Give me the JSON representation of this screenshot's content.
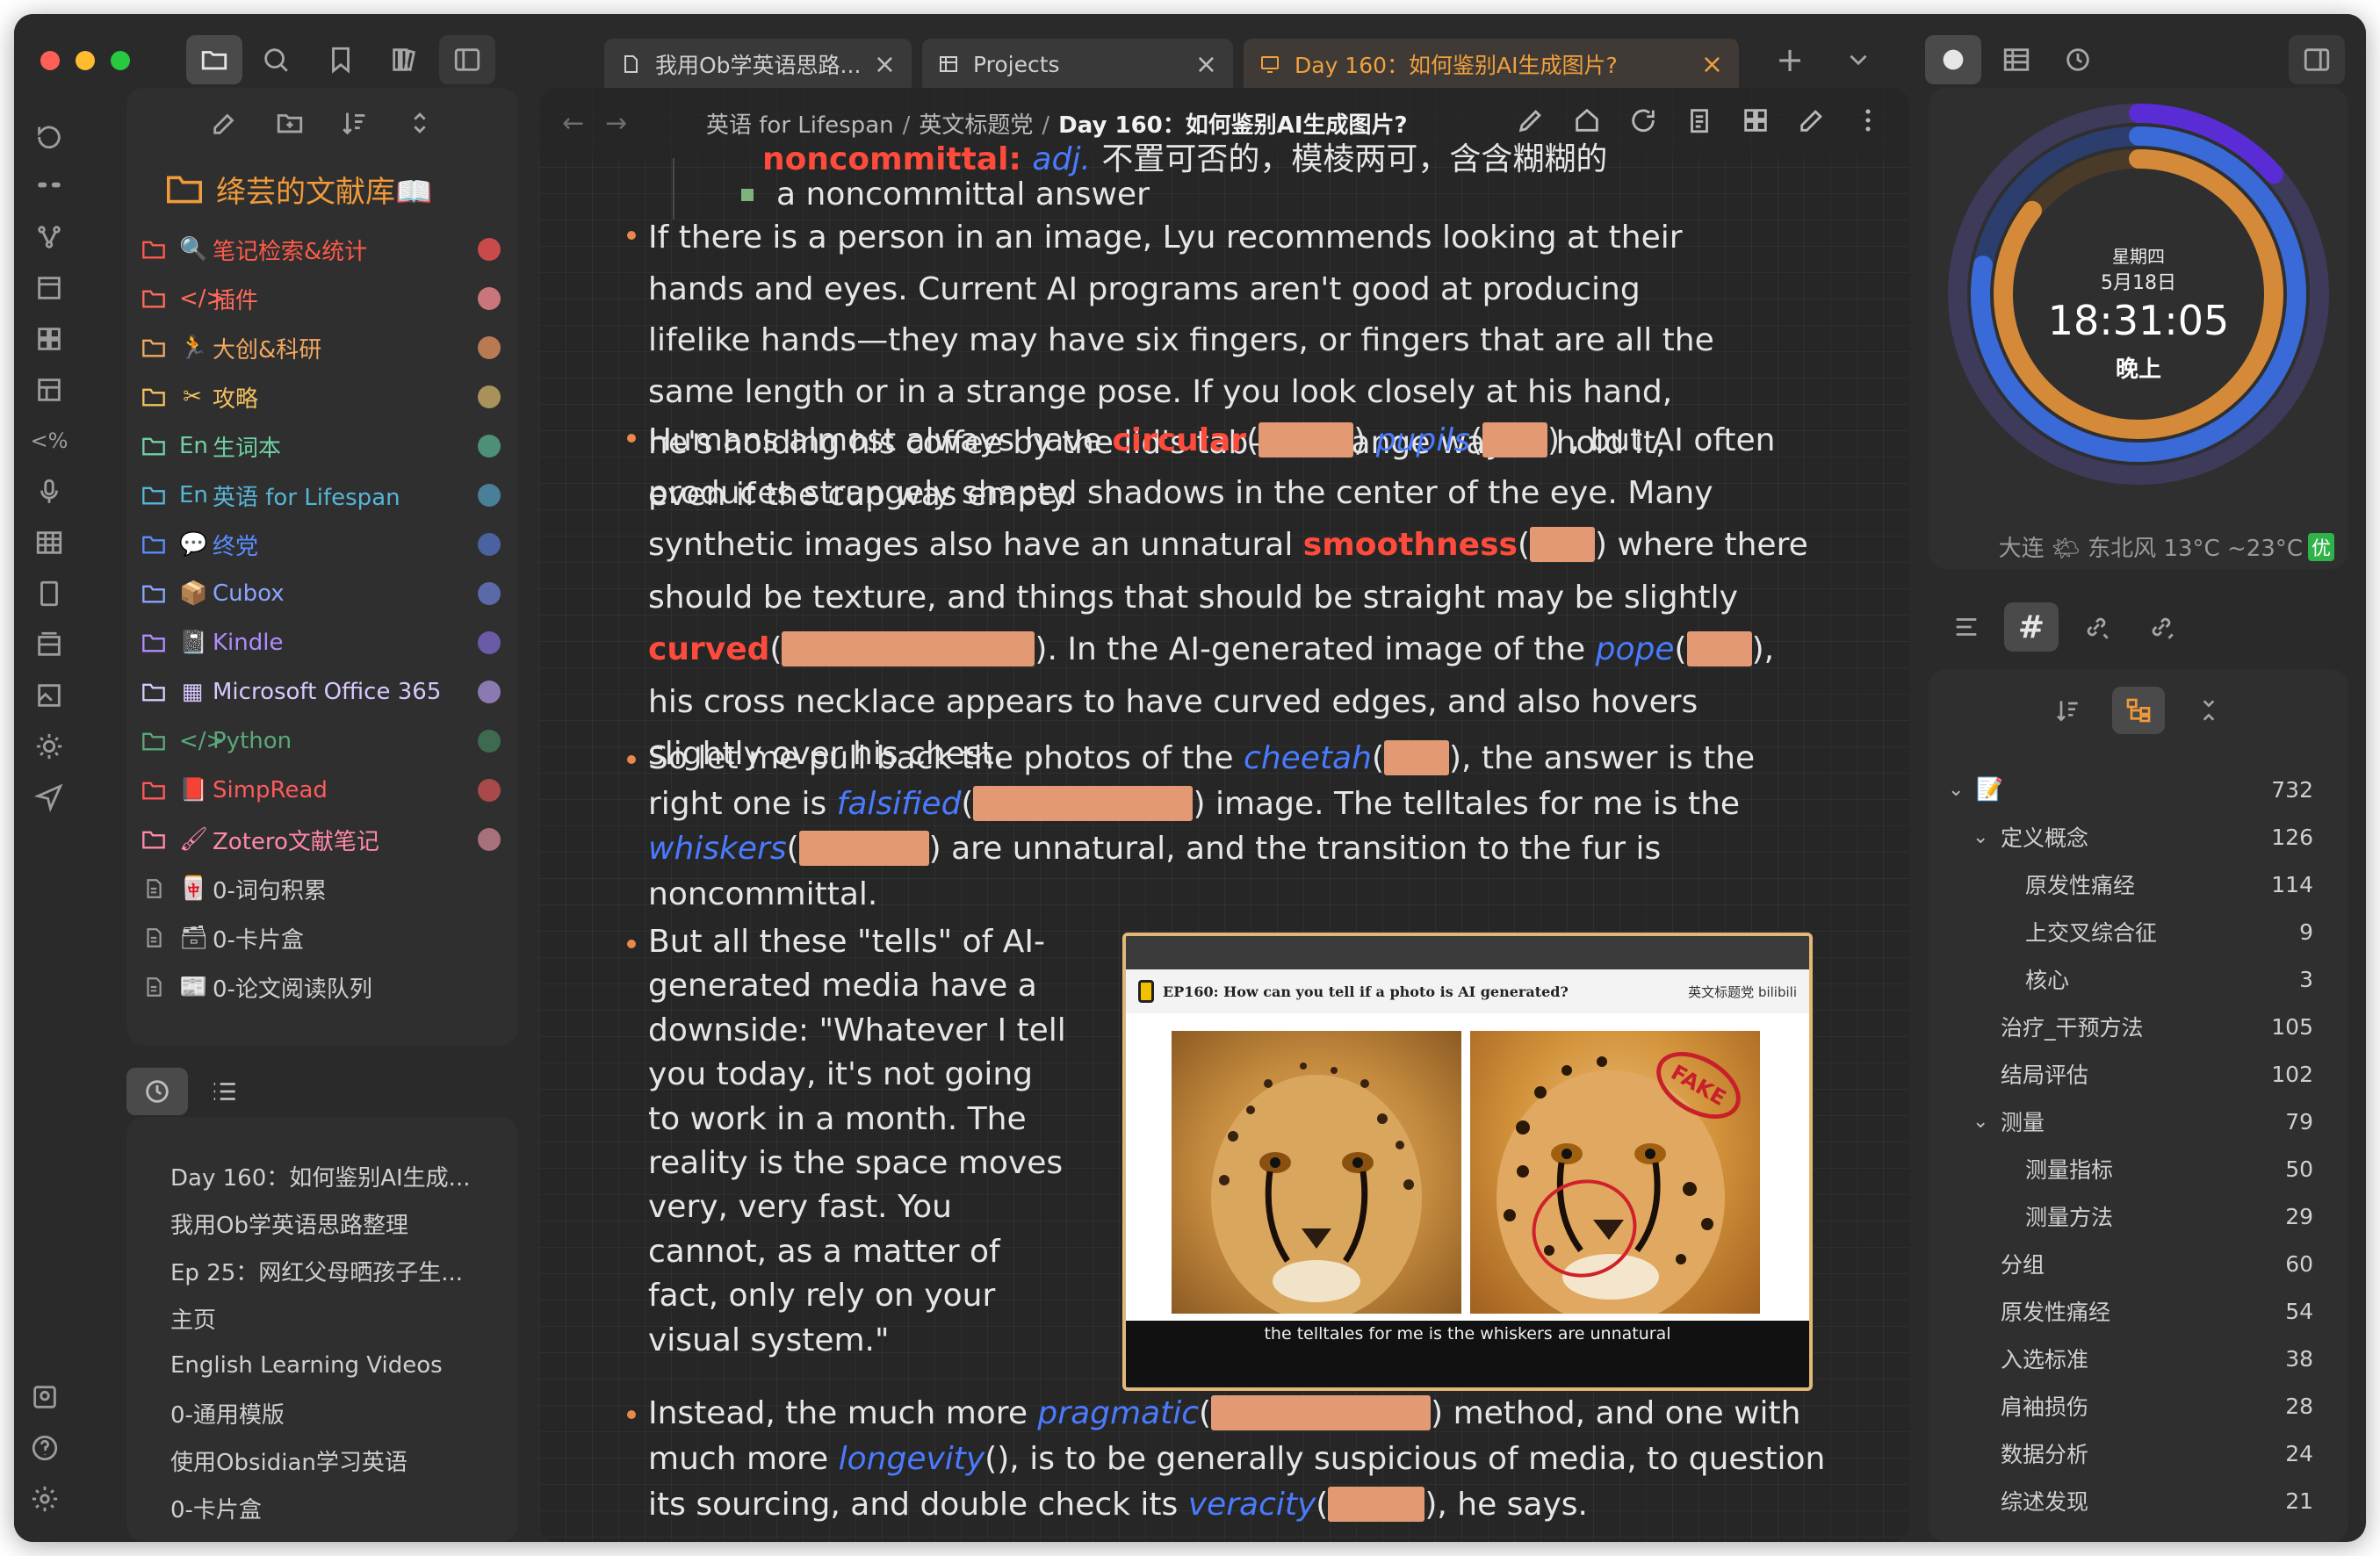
{
  "tabs": [
    {
      "label": "我用Ob学英语思路...",
      "active": false
    },
    {
      "label": "Projects",
      "active": false
    },
    {
      "label": "Day 160：如何鉴别AI生成图片?",
      "active": true
    }
  ],
  "sidebar": {
    "vault_name": "绛芸的文献库📖",
    "items": [
      {
        "label": "笔记检索&统计",
        "emoji": "🔍",
        "color": "#ff5a4a",
        "dot": "#c94a4a",
        "type": "folder"
      },
      {
        "label": "插件",
        "emoji": "</>",
        "color": "#ff6a5a",
        "dot": "#c9767a",
        "type": "folder"
      },
      {
        "label": "大创&科研",
        "emoji": "🏃",
        "color": "#f2a860",
        "dot": "#b87a52",
        "type": "folder"
      },
      {
        "label": "攻略",
        "emoji": "✂",
        "color": "#f2c060",
        "dot": "#a8925a",
        "type": "folder"
      },
      {
        "label": "生词本",
        "emoji": "En",
        "color": "#6fd1a4",
        "dot": "#4e8f78",
        "type": "folder"
      },
      {
        "label": "英语 for Lifespan",
        "emoji": "En",
        "color": "#56b6d8",
        "dot": "#4a7f98",
        "type": "folder"
      },
      {
        "label": "终党",
        "emoji": "💬",
        "color": "#5a8cff",
        "dot": "#4a62a0",
        "type": "folder"
      },
      {
        "label": "Cubox",
        "emoji": "📦",
        "color": "#8aa4ff",
        "dot": "#5a6aa8",
        "type": "folder"
      },
      {
        "label": "Kindle",
        "emoji": "📓",
        "color": "#b08cff",
        "dot": "#6a5aa8",
        "type": "folder"
      },
      {
        "label": "Microsoft Office 365",
        "emoji": "▦",
        "color": "#d9c8ff",
        "dot": "#8a7ab0",
        "type": "folder"
      },
      {
        "label": "Python",
        "emoji": "</>",
        "color": "#5aa87a",
        "dot": "#3e6a50",
        "type": "folder"
      },
      {
        "label": "SimpRead",
        "emoji": "📕",
        "color": "#ff5a5a",
        "dot": "#a84a4a",
        "type": "folder"
      },
      {
        "label": "Zotero文献笔记",
        "emoji": "🖌",
        "color": "#ff8aa8",
        "dot": "#a8707a",
        "type": "folder"
      },
      {
        "label": "0-词句积累",
        "emoji": "🀄",
        "color": "#cfcfcf",
        "dot": "",
        "type": "file"
      },
      {
        "label": "0-卡片盒",
        "emoji": "🗃",
        "color": "#cfcfcf",
        "dot": "",
        "type": "file"
      },
      {
        "label": "0-论文阅读队列",
        "emoji": "📰",
        "color": "#cfcfcf",
        "dot": "",
        "type": "file"
      }
    ]
  },
  "recent": [
    "Day 160：如何鉴别AI生成...",
    "我用Ob学英语思路整理",
    "Ep 25：网红父母晒孩子生...",
    "主页",
    "English Learning Videos",
    "0-通用模版",
    "使用Obsidian学习英语",
    "0-卡片盒"
  ],
  "breadcrumb": {
    "parts": [
      "英语 for Lifespan",
      "英文标题党"
    ],
    "current": "Day 160：如何鉴别AI生成图片?"
  },
  "note": {
    "cut_top": {
      "word": "noncommittal:",
      "pos": "adj.",
      "def": " 不置可否的，模棱两可，含含糊糊的"
    },
    "sub_item": "a noncommittal answer",
    "p1": "If there is a person in an image, Lyu recommends looking at their hands and eyes. Current AI programs aren't good at producing lifelike hands—they may have six fingers, or fingers that are all the same length or in a strange pose. If you look closely at his hand, he's holding his coffee by the lid's tab—a strange way to hold it, even if the cup was empty.",
    "p2": {
      "a": "Humans almost always have ",
      "kw1": "circular",
      "kw2": "pupils",
      "b": " , but AI often",
      "c": "produces strangely shaped shadows in the center of the eye. Many",
      "d": "synthetic images also have an unnatural ",
      "kw3": "smoothness",
      "e": " where there",
      "f": "should be texture, and things that should be straight may be slightly",
      "kw4": "curved",
      "g": ". In the AI-generated image of the ",
      "kw5": "pope",
      "h": ",",
      "i": "his cross necklace appears to have curved edges, and also hovers",
      "j": "slightly over his chest."
    },
    "p3": {
      "a": "So let me pull back the photos of the ",
      "kw1": "cheetah",
      "b": ", the answer is the",
      "c": "right one is ",
      "kw2": "falsified",
      "d": " image. The telltales for me is the",
      "kw3": "whiskers",
      "e": " are unnatural, and the transition to the fur is",
      "f": "noncommittal."
    },
    "p4": [
      "But all these \"tells\" of AI-",
      "generated media have a",
      "downside: \"Whatever I tell",
      "you today, it's not going",
      "to work in a month. The",
      "reality is the space moves",
      "very, very fast. You",
      "cannot, as a matter of",
      "fact, only rely on your",
      "visual system.\""
    ],
    "p5": {
      "a": "Instead, the much more ",
      "kw1": "pragmatic",
      "b": " method, and one with",
      "c": "much more ",
      "kw2": "longevity",
      "d": "(), is to be generally suspicious of media, to question",
      "e": "its sourcing, and double check its ",
      "kw3": "veracity",
      "f": ", he says."
    }
  },
  "embed": {
    "title": "EP160: How can you tell if a photo is AI generated?",
    "brand": "英文标题党 bilibili",
    "stamp": "FAKE",
    "subtitle": "the telltales for me is the whiskers are unnatural"
  },
  "clock": {
    "weekday": "星期四",
    "date": "5月18日",
    "time": "18:31:05",
    "ampm": "晚上",
    "weather": "大连 🌤 东北风 13°C ~23°C",
    "aqi": "优"
  },
  "tags": [
    {
      "label": "📝",
      "count": "732",
      "level": 0,
      "chevron": true
    },
    {
      "label": "定义概念",
      "count": "126",
      "level": 1,
      "chevron": true
    },
    {
      "label": "原发性痛经",
      "count": "114",
      "level": 2,
      "chevron": false
    },
    {
      "label": "上交叉综合征",
      "count": "9",
      "level": 2,
      "chevron": false
    },
    {
      "label": "核心",
      "count": "3",
      "level": 2,
      "chevron": false
    },
    {
      "label": "治疗_干预方法",
      "count": "105",
      "level": 1,
      "chevron": false
    },
    {
      "label": "结局评估",
      "count": "102",
      "level": 1,
      "chevron": false
    },
    {
      "label": "测量",
      "count": "79",
      "level": 1,
      "chevron": true
    },
    {
      "label": "测量指标",
      "count": "50",
      "level": 2,
      "chevron": false
    },
    {
      "label": "测量方法",
      "count": "29",
      "level": 2,
      "chevron": false
    },
    {
      "label": "分组",
      "count": "60",
      "level": 1,
      "chevron": false
    },
    {
      "label": "原发性痛经",
      "count": "54",
      "level": 1,
      "chevron": false
    },
    {
      "label": "入选标准",
      "count": "38",
      "level": 1,
      "chevron": false
    },
    {
      "label": "肩袖损伤",
      "count": "28",
      "level": 1,
      "chevron": false
    },
    {
      "label": "数据分析",
      "count": "24",
      "level": 1,
      "chevron": false
    },
    {
      "label": "综述发现",
      "count": "21",
      "level": 1,
      "chevron": false
    }
  ],
  "colors": {
    "accent": "#f09a3a",
    "keyword_red": "#ff4b3c",
    "keyword_blue": "#4a7bff",
    "blank": "#e39a74"
  }
}
